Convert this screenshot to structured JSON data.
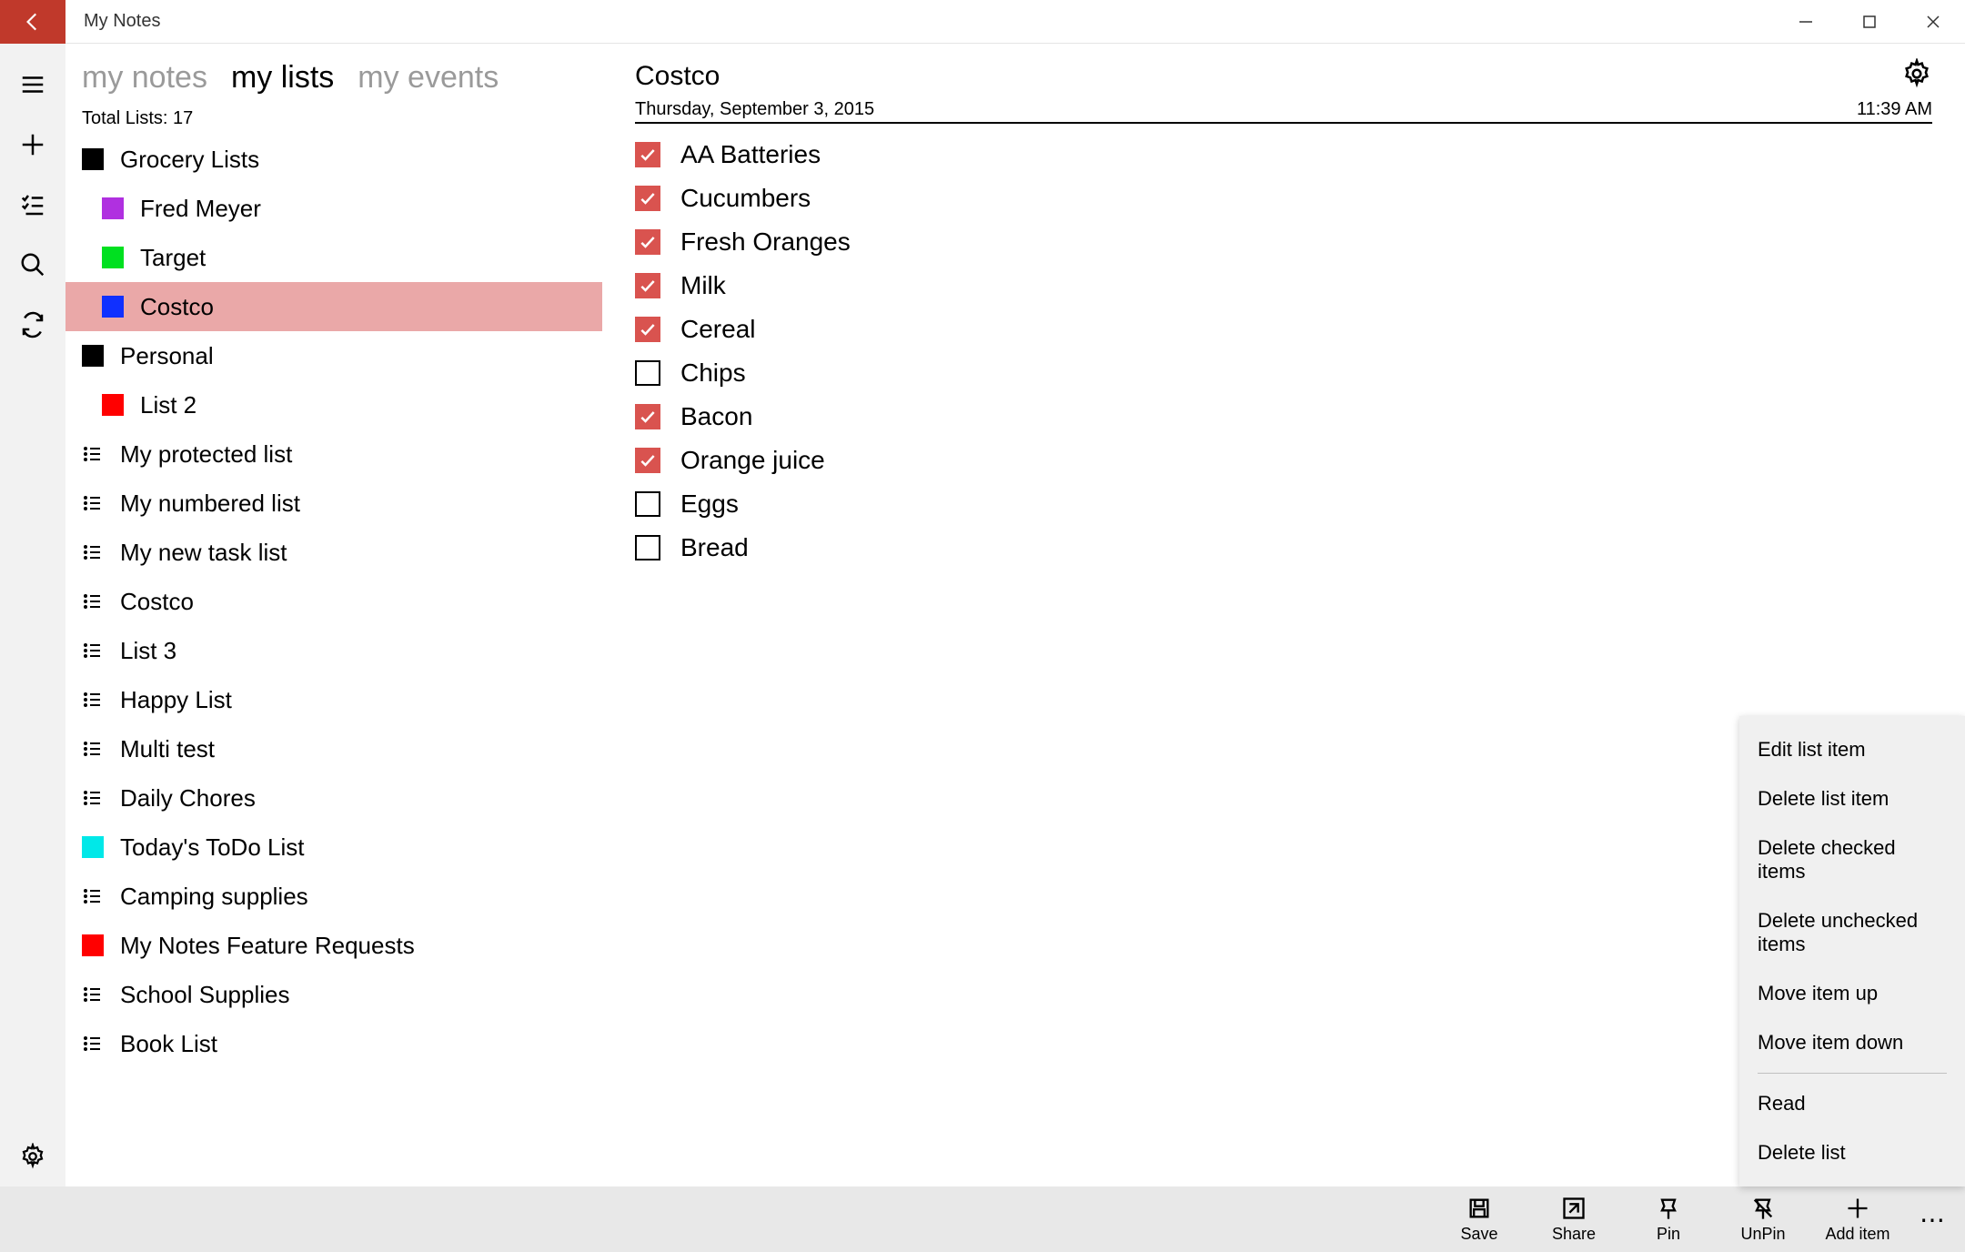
{
  "app_title": "My Notes",
  "tabs": {
    "notes": "my notes",
    "lists": "my lists",
    "events": "my events"
  },
  "total_line": "Total Lists: 17",
  "sidebar_tree": [
    {
      "kind": "folder",
      "label": "Grocery Lists",
      "color": "#000000",
      "indent": 0
    },
    {
      "kind": "list",
      "label": "Fred Meyer",
      "color": "#b030e0",
      "indent": 1
    },
    {
      "kind": "list",
      "label": "Target",
      "color": "#00e020",
      "indent": 1
    },
    {
      "kind": "list",
      "label": "Costco",
      "color": "#1030ff",
      "indent": 1,
      "selected": true
    },
    {
      "kind": "folder",
      "label": "Personal",
      "color": "#000000",
      "indent": 0
    },
    {
      "kind": "list",
      "label": "List 2",
      "color": "#ff0000",
      "indent": 1
    },
    {
      "kind": "glyph",
      "label": "My protected list",
      "indent": 0
    },
    {
      "kind": "glyph",
      "label": "My numbered list",
      "indent": 0
    },
    {
      "kind": "glyph",
      "label": "My new task list",
      "indent": 0
    },
    {
      "kind": "glyph",
      "label": "Costco",
      "indent": 0
    },
    {
      "kind": "glyph",
      "label": "List 3",
      "indent": 0
    },
    {
      "kind": "glyph",
      "label": "Happy List",
      "indent": 0
    },
    {
      "kind": "glyph",
      "label": "Multi test",
      "indent": 0
    },
    {
      "kind": "glyph",
      "label": "Daily Chores",
      "indent": 0
    },
    {
      "kind": "list",
      "label": "Today's ToDo List",
      "color": "#00e8e8",
      "indent": 0
    },
    {
      "kind": "glyph",
      "label": "Camping supplies",
      "indent": 0
    },
    {
      "kind": "list",
      "label": "My Notes Feature Requests",
      "color": "#ff0000",
      "indent": 0
    },
    {
      "kind": "glyph",
      "label": "School Supplies",
      "indent": 0
    },
    {
      "kind": "glyph",
      "label": "Book List",
      "indent": 0
    }
  ],
  "content": {
    "title": "Costco",
    "date": "Thursday, September 3, 2015",
    "time": "11:39 AM",
    "items": [
      {
        "label": "AA Batteries",
        "checked": true
      },
      {
        "label": "Cucumbers",
        "checked": true
      },
      {
        "label": "Fresh Oranges",
        "checked": true
      },
      {
        "label": "Milk",
        "checked": true
      },
      {
        "label": "Cereal",
        "checked": true
      },
      {
        "label": "Chips",
        "checked": false
      },
      {
        "label": "Bacon",
        "checked": true
      },
      {
        "label": "Orange juice",
        "checked": true
      },
      {
        "label": "Eggs",
        "checked": false
      },
      {
        "label": "Bread",
        "checked": false
      }
    ]
  },
  "context_menu": [
    "Edit list item",
    "Delete list item",
    "Delete checked items",
    "Delete unchecked items",
    "Move item up",
    "Move item down",
    "---",
    "Read",
    "Delete list"
  ],
  "cmdbar": {
    "save": "Save",
    "share": "Share",
    "pin": "Pin",
    "unpin": "UnPin",
    "add": "Add item"
  }
}
